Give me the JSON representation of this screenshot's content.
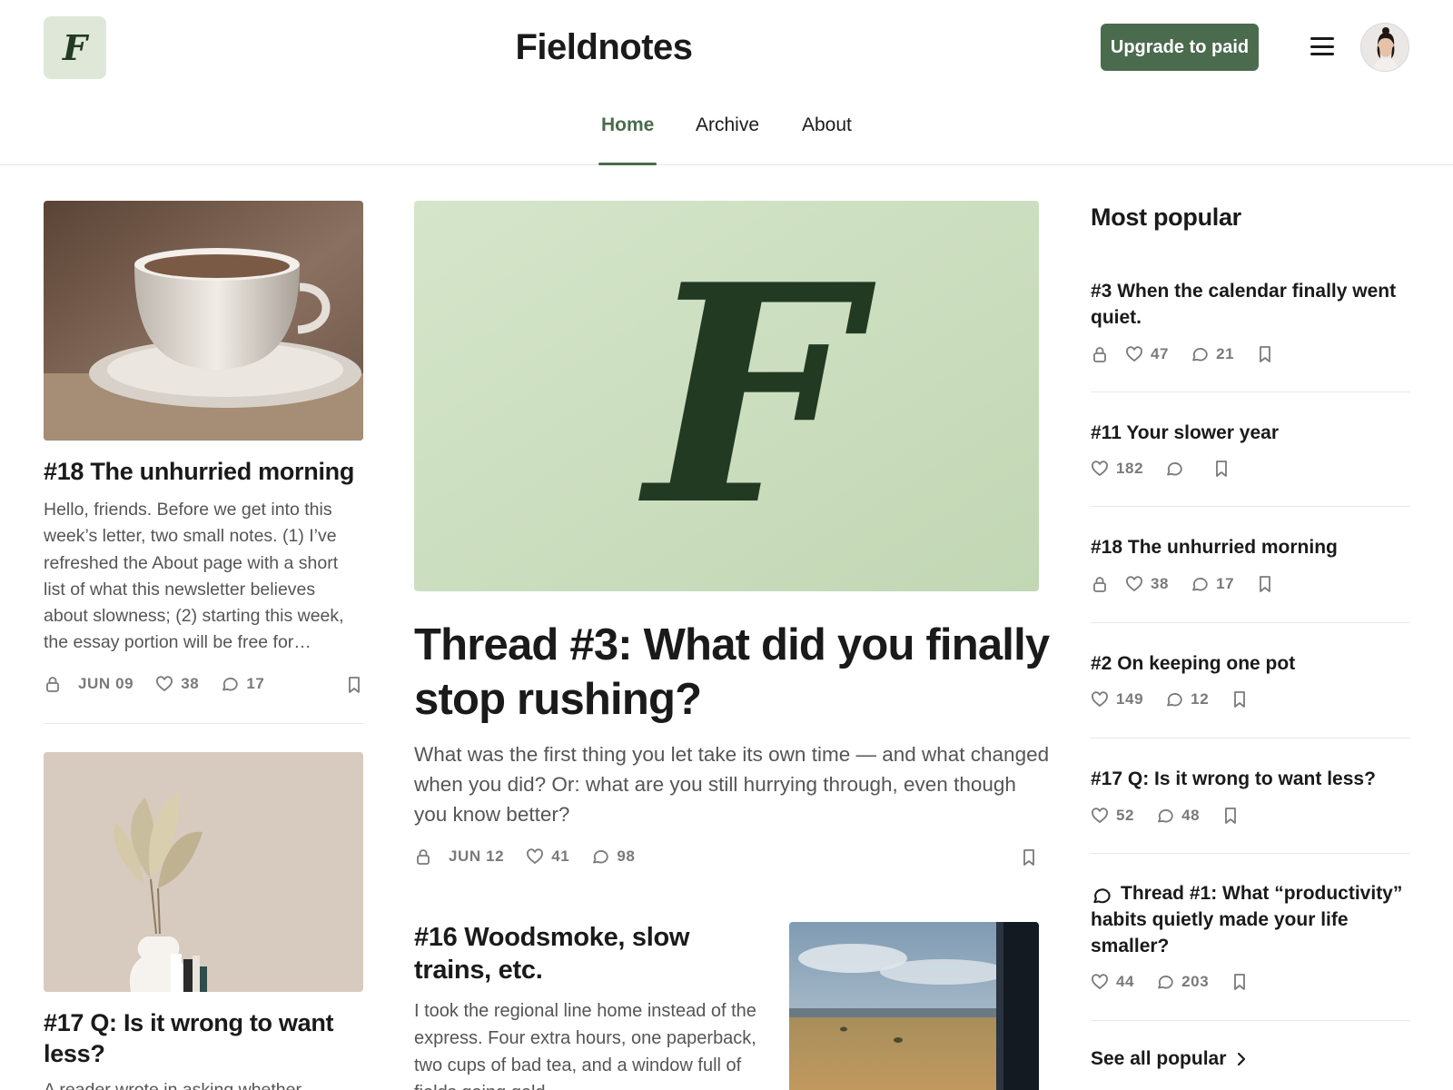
{
  "header": {
    "logo_letter": "F",
    "site_title": "Fieldnotes",
    "upgrade_label": "Upgrade to paid"
  },
  "nav": {
    "tabs": [
      {
        "label": "Home",
        "active": true
      },
      {
        "label": "Archive",
        "active": false
      },
      {
        "label": "About",
        "active": false
      }
    ]
  },
  "left_posts": [
    {
      "title": "#18 The unhurried morning",
      "excerpt": "Hello, friends. Before we get into this week’s letter, two small notes. (1) I’ve refreshed the About page with a short list of what this newsletter believes about slowness; (2) starting this week, the essay portion will be free for…",
      "date": "JUN 09",
      "likes": "38",
      "comments": "17",
      "locked": true,
      "image": "coffee-cup-photo"
    },
    {
      "title": "#17 Q: Is it wrong to want less?",
      "excerpt": "A reader wrote in asking whether",
      "image": "dried-palm-vase-photo"
    }
  ],
  "featured": {
    "image_letter": "F",
    "title": "Thread #3: What did you finally stop rushing?",
    "excerpt": "What was the first thing you let take its own time — and what changed when you did? Or: what are you still hurrying through, even though you know better?",
    "date": "JUN 12",
    "likes": "41",
    "comments": "98",
    "locked": true
  },
  "secondary_post": {
    "title": "#16 Woodsmoke, slow trains, etc.",
    "excerpt": "I took the regional line home instead of the express. Four extra hours, one paperback, two cups of bad tea, and a window full of fields going gold.",
    "image": "train-window-fields-photo"
  },
  "sidebar": {
    "heading": "Most popular",
    "items": [
      {
        "title": "#3 When the calendar finally went quiet.",
        "locked": true,
        "likes": "47",
        "comments": "21"
      },
      {
        "title": "#11 Your slower year",
        "locked": false,
        "likes": "182",
        "comments": ""
      },
      {
        "title": "#18 The unhurried morning",
        "locked": true,
        "likes": "38",
        "comments": "17"
      },
      {
        "title": "#2 On keeping one pot",
        "locked": false,
        "likes": "149",
        "comments": "12"
      },
      {
        "title": "#17 Q: Is it wrong to want less?",
        "locked": false,
        "likes": "52",
        "comments": "48"
      },
      {
        "title": "Thread #1: What “productivity” habits quietly made your life smaller?",
        "locked": false,
        "likes": "44",
        "comments": "203",
        "thread": true
      }
    ],
    "see_all_label": "See all popular"
  },
  "colors": {
    "accent": "#4a6b4d",
    "logo_bg": "#dfe8d8",
    "hero_bg": "#cfe0c3",
    "logo_letter": "#233a22"
  },
  "icons": {
    "lock": "lock-icon",
    "like": "heart-icon",
    "comment": "comment-icon",
    "bookmark": "bookmark-icon",
    "menu": "hamburger-menu-icon",
    "chevron": "chevron-right-icon"
  }
}
